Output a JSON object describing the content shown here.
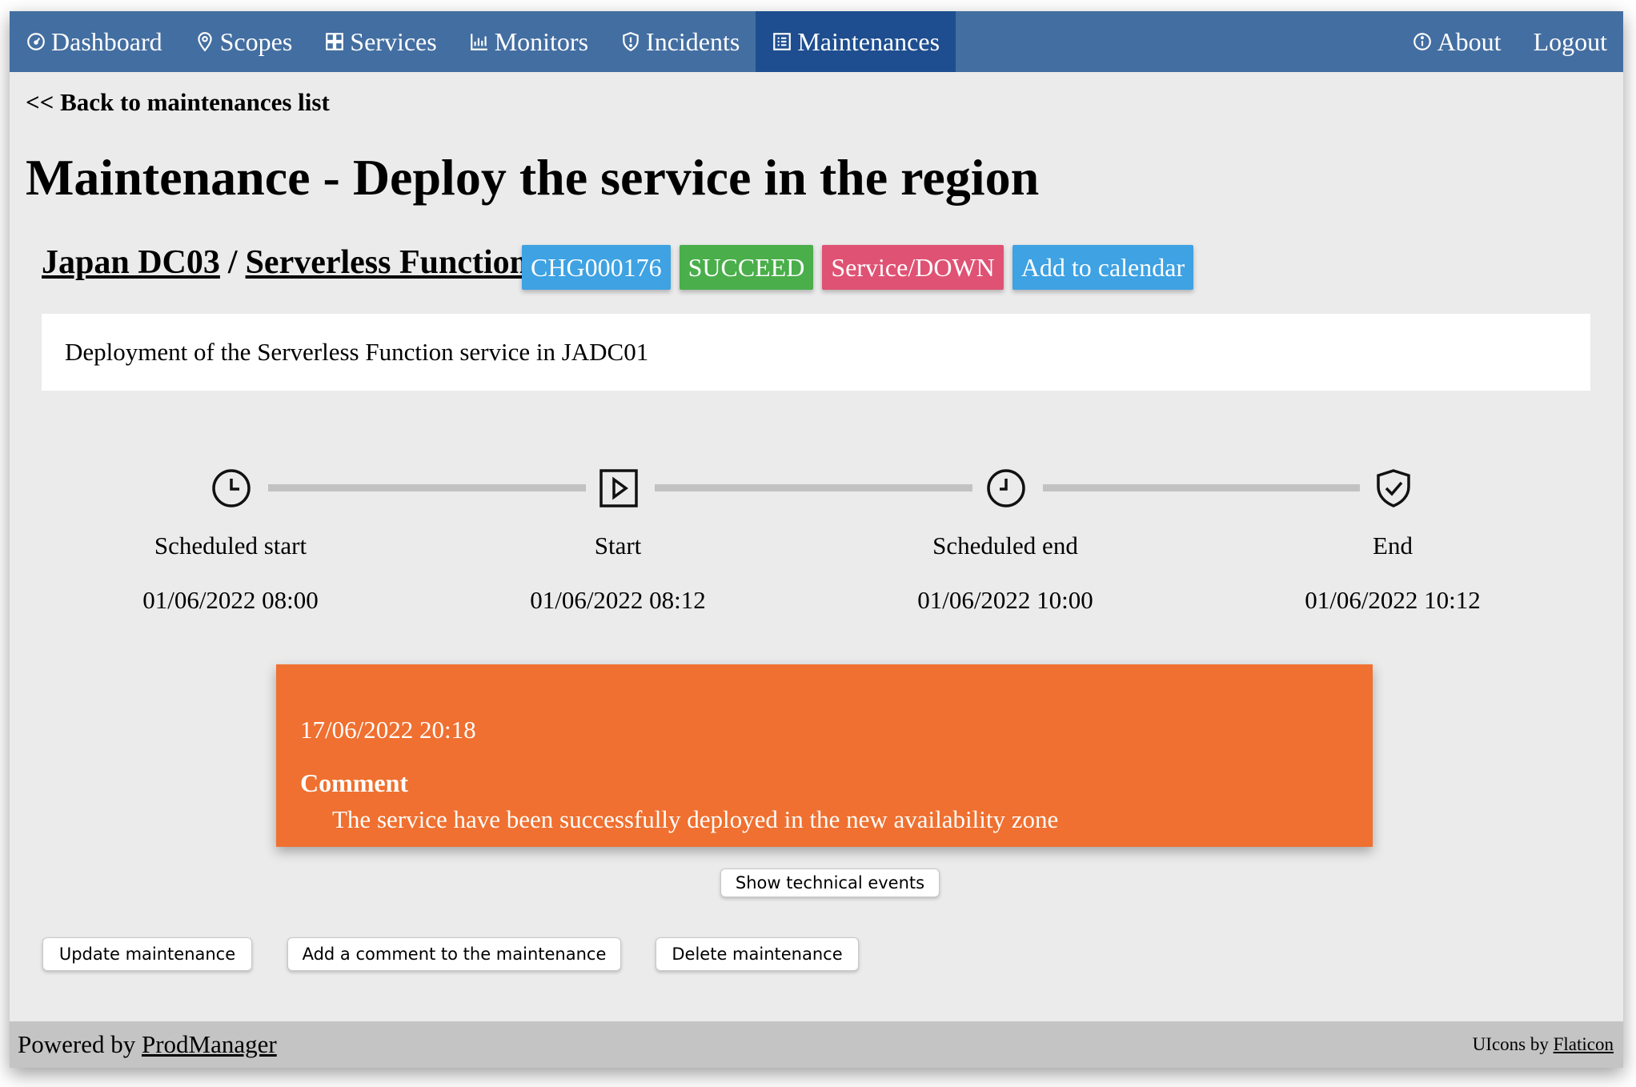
{
  "nav": {
    "items": [
      {
        "label": "Dashboard",
        "icon": "gauge-icon"
      },
      {
        "label": "Scopes",
        "icon": "location-pin-icon"
      },
      {
        "label": "Services",
        "icon": "grid-icon"
      },
      {
        "label": "Monitors",
        "icon": "chart-icon"
      },
      {
        "label": "Incidents",
        "icon": "shield-alert-icon"
      },
      {
        "label": "Maintenances",
        "icon": "list-icon",
        "active": true
      }
    ],
    "about": "About",
    "logout": "Logout"
  },
  "back_link": "<< Back to maintenances list",
  "title": "Maintenance - Deploy the service in the region",
  "breadcrumb": {
    "scope": "Japan DC03",
    "separator": "/",
    "service": "Serverless Function"
  },
  "badges": {
    "change_id": "CHG000176",
    "status": "SUCCEED",
    "impact": "Service/DOWN",
    "calendar": "Add to calendar"
  },
  "description": "Deployment of the Serverless Function service in JADC01",
  "timeline": [
    {
      "label": "Scheduled start",
      "date": "01/06/2022 08:00",
      "icon": "clock-icon"
    },
    {
      "label": "Start",
      "date": "01/06/2022 08:12",
      "icon": "play-icon"
    },
    {
      "label": "Scheduled end",
      "date": "01/06/2022 10:00",
      "icon": "clock-icon"
    },
    {
      "label": "End",
      "date": "01/06/2022 10:12",
      "icon": "shield-check-icon"
    }
  ],
  "comment": {
    "date": "17/06/2022 20:18",
    "title": "Comment",
    "text": "The service have been successfully deployed in the new availability zone"
  },
  "buttons": {
    "show_events": "Show technical events",
    "update": "Update maintenance",
    "add_comment": "Add a comment to the maintenance",
    "delete": "Delete maintenance"
  },
  "footer": {
    "powered_by": "Powered by",
    "powered_link": "ProdManager",
    "icons_by": "UIcons by",
    "icons_link": "Flaticon"
  },
  "colors": {
    "navbar": "#436ea1",
    "navbar_active": "#1e4e8f",
    "badge_blue": "#3ea2e3",
    "badge_green": "#4aae4b",
    "badge_red": "#df5274",
    "comment_bg": "#ef7030"
  }
}
